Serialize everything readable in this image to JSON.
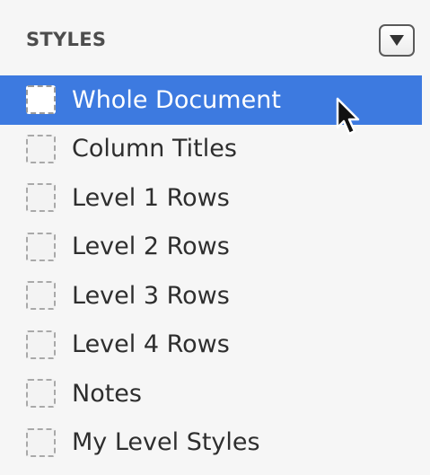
{
  "panel": {
    "header": {
      "title": "STYLES",
      "menu_icon": "triangle-down-icon"
    },
    "styles": [
      {
        "label": "Whole Document",
        "selected": true
      },
      {
        "label": "Column Titles",
        "selected": false
      },
      {
        "label": "Level 1 Rows",
        "selected": false
      },
      {
        "label": "Level 2 Rows",
        "selected": false
      },
      {
        "label": "Level 3 Rows",
        "selected": false
      },
      {
        "label": "Level 4 Rows",
        "selected": false
      },
      {
        "label": "Notes",
        "selected": false
      },
      {
        "label": "My Level Styles",
        "selected": false
      }
    ]
  },
  "colors": {
    "selection": "#3d7ae0",
    "background": "#f6f6f6",
    "header_text": "#4d4d4d",
    "row_text": "#2e2e2e"
  }
}
